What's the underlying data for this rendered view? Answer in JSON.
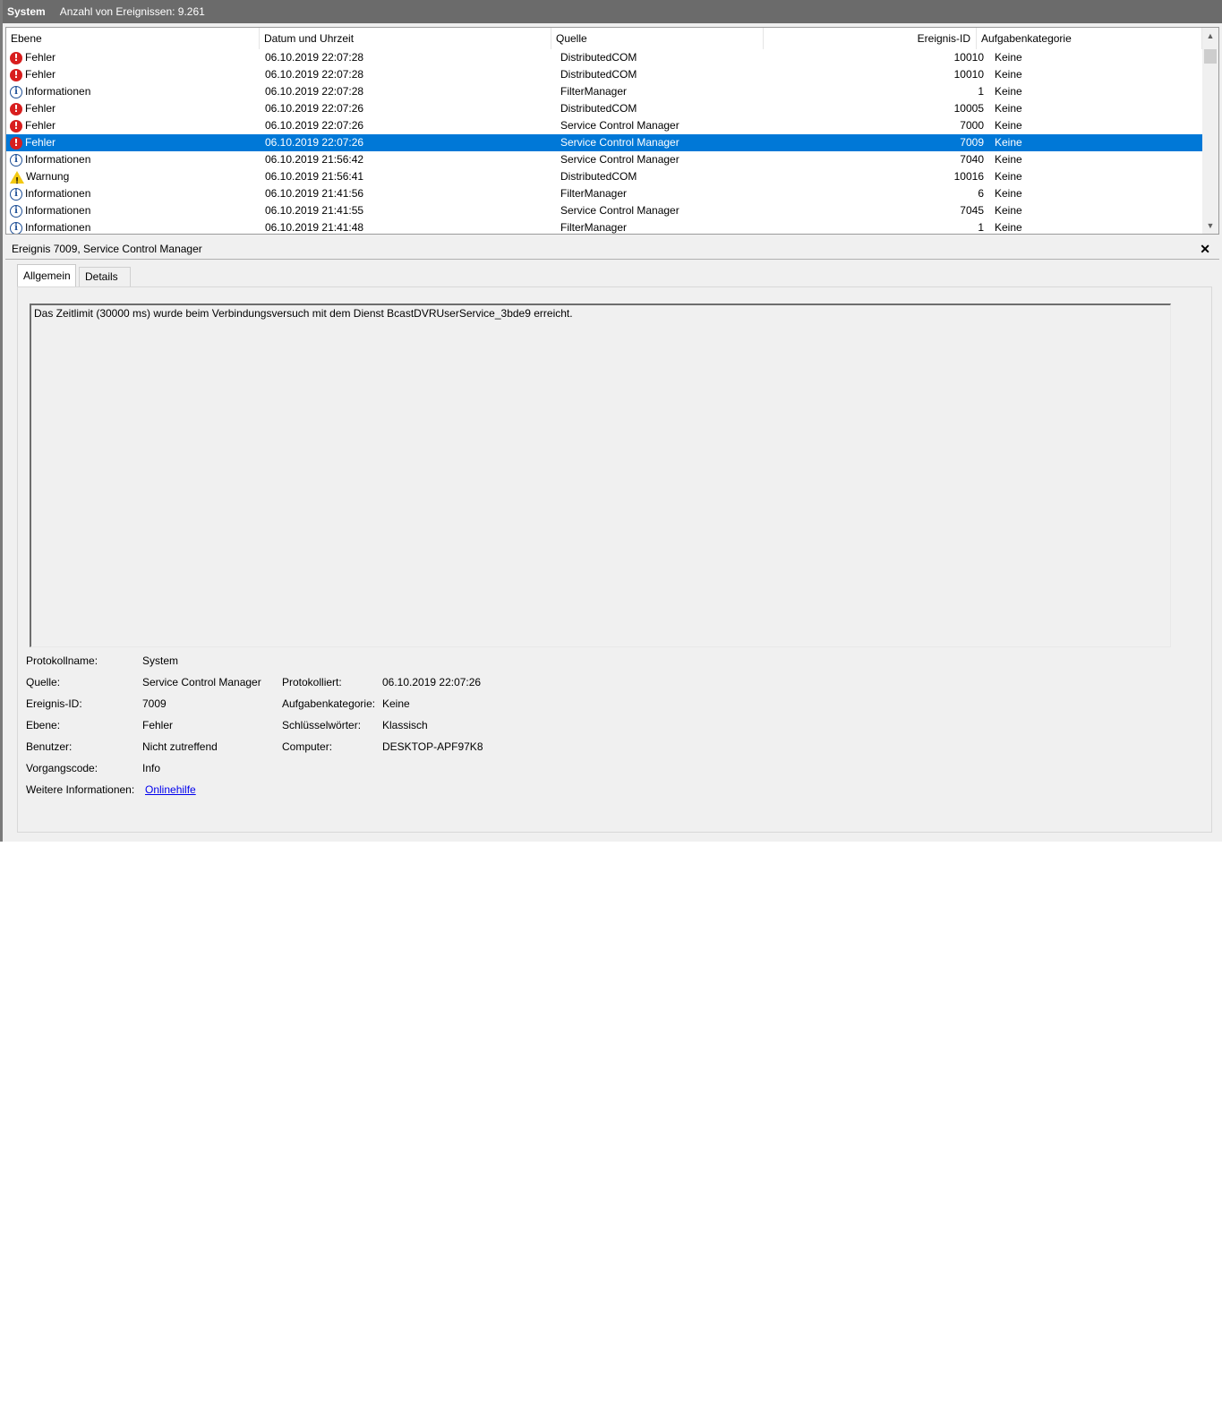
{
  "window": {
    "log_name": "System",
    "event_count": "Anzahl von Ereignissen: 9.261"
  },
  "columns": {
    "level": "Ebene",
    "date": "Datum und Uhrzeit",
    "source": "Quelle",
    "event_id": "Ereignis-ID",
    "category": "Aufgabenkategorie"
  },
  "events": [
    {
      "level": "Fehler",
      "icon": "error-icon",
      "date": "06.10.2019 22:07:28",
      "source": "DistributedCOM",
      "id": "10010",
      "category": "Keine"
    },
    {
      "level": "Fehler",
      "icon": "error-icon",
      "date": "06.10.2019 22:07:28",
      "source": "DistributedCOM",
      "id": "10010",
      "category": "Keine"
    },
    {
      "level": "Informationen",
      "icon": "info-icon",
      "date": "06.10.2019 22:07:28",
      "source": "FilterManager",
      "id": "1",
      "category": "Keine"
    },
    {
      "level": "Fehler",
      "icon": "error-icon",
      "date": "06.10.2019 22:07:26",
      "source": "DistributedCOM",
      "id": "10005",
      "category": "Keine"
    },
    {
      "level": "Fehler",
      "icon": "error-icon",
      "date": "06.10.2019 22:07:26",
      "source": "Service Control Manager",
      "id": "7000",
      "category": "Keine"
    },
    {
      "level": "Fehler",
      "icon": "error-icon",
      "date": "06.10.2019 22:07:26",
      "source": "Service Control Manager",
      "id": "7009",
      "category": "Keine",
      "selected": true
    },
    {
      "level": "Informationen",
      "icon": "info-icon",
      "date": "06.10.2019 21:56:42",
      "source": "Service Control Manager",
      "id": "7040",
      "category": "Keine"
    },
    {
      "level": "Warnung",
      "icon": "warning-icon",
      "date": "06.10.2019 21:56:41",
      "source": "DistributedCOM",
      "id": "10016",
      "category": "Keine"
    },
    {
      "level": "Informationen",
      "icon": "info-icon",
      "date": "06.10.2019 21:41:56",
      "source": "FilterManager",
      "id": "6",
      "category": "Keine"
    },
    {
      "level": "Informationen",
      "icon": "info-icon",
      "date": "06.10.2019 21:41:55",
      "source": "Service Control Manager",
      "id": "7045",
      "category": "Keine"
    },
    {
      "level": "Informationen",
      "icon": "info-icon",
      "date": "06.10.2019 21:41:48",
      "source": "FilterManager",
      "id": "1",
      "category": "Keine"
    }
  ],
  "detail": {
    "title": "Ereignis 7009, Service Control Manager",
    "close_glyph": "✕",
    "tabs": [
      "Allgemein",
      "Details"
    ],
    "message": "Das Zeitlimit (30000 ms) wurde beim Verbindungsversuch mit dem Dienst BcastDVRUserService_3bde9 erreicht.",
    "labels": {
      "log_name": "Protokollname:",
      "source": "Quelle:",
      "event_id": "Ereignis-ID:",
      "level": "Ebene:",
      "user": "Benutzer:",
      "opcode": "Vorgangscode:",
      "more_info": "Weitere Informationen:",
      "logged": "Protokolliert:",
      "task_category": "Aufgabenkategorie:",
      "keywords": "Schlüsselwörter:",
      "computer": "Computer:"
    },
    "values": {
      "log_name": "System",
      "source": "Service Control Manager",
      "event_id": "7009",
      "level": "Fehler",
      "user": "Nicht zutreffend",
      "opcode": "Info",
      "more_info_link": "Onlinehilfe",
      "logged": "06.10.2019 22:07:26",
      "task_category": "Keine",
      "keywords": "Klassisch",
      "computer": "DESKTOP-APF97K8"
    }
  },
  "colors": {
    "title_bar": "#6b6b6b",
    "selection": "#0078d7",
    "error": "#d81e1e",
    "info": "#1e4f96",
    "warning": "#f2c811",
    "link": "#0000ee"
  }
}
